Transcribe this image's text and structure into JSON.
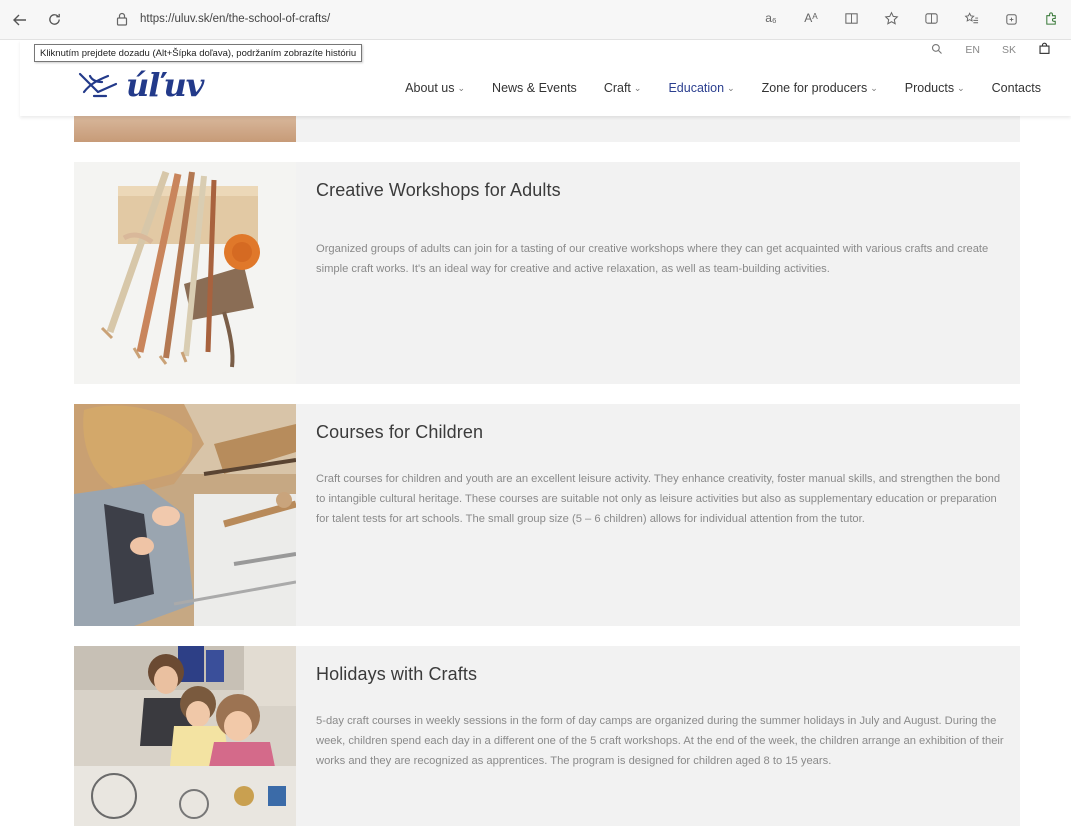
{
  "browser": {
    "url": "https://uluv.sk/en/the-school-of-crafts/",
    "tooltip": "Kliknutím prejdete dozadu (Alt+Šípka doľava), podržaním zobrazíte históriu",
    "read_aloud": "Aᴬ",
    "translate": "a₆"
  },
  "utility": {
    "lang_en": "EN",
    "lang_sk": "SK"
  },
  "logo": {
    "text": "úľuv"
  },
  "nav": {
    "items": [
      {
        "label": "About us",
        "dropdown": true
      },
      {
        "label": "News & Events",
        "dropdown": false
      },
      {
        "label": "Craft",
        "dropdown": true
      },
      {
        "label": "Education",
        "dropdown": true,
        "active": true
      },
      {
        "label": "Zone for producers",
        "dropdown": true
      },
      {
        "label": "Products",
        "dropdown": true
      },
      {
        "label": "Contacts",
        "dropdown": false
      }
    ]
  },
  "cards": [
    {
      "title": "Creative Workshops for Adults",
      "body": "Organized groups of adults can join for a tasting of our creative workshops where they can get acquainted with various crafts and create simple craft works. It's an ideal way for creative and active relaxation, as well as team-building activities."
    },
    {
      "title": "Courses for Children",
      "body": "Craft courses for children and youth are an excellent leisure activity. They enhance creativity, foster manual skills, and strengthen the bond to intangible cultural heritage. These courses are suitable not only as leisure activities but also as supplementary education or preparation for talent tests for art schools. The small group size (5 – 6 children) allows for individual attention from the tutor."
    },
    {
      "title": "Holidays with Crafts",
      "body": "5-day craft courses in weekly sessions in the form of day camps are organized during the summer holidays in July and August. During the week, children spend each day in a different one of the 5 craft workshops. At the end of the week, the children arrange an exhibition of their works and they are recognized as apprentices. The program is designed for children aged 8 to 15 years."
    }
  ],
  "colors": {
    "brand": "#233a8a",
    "card_bg": "#f2f2f2",
    "body_text": "#8a8a8a"
  }
}
